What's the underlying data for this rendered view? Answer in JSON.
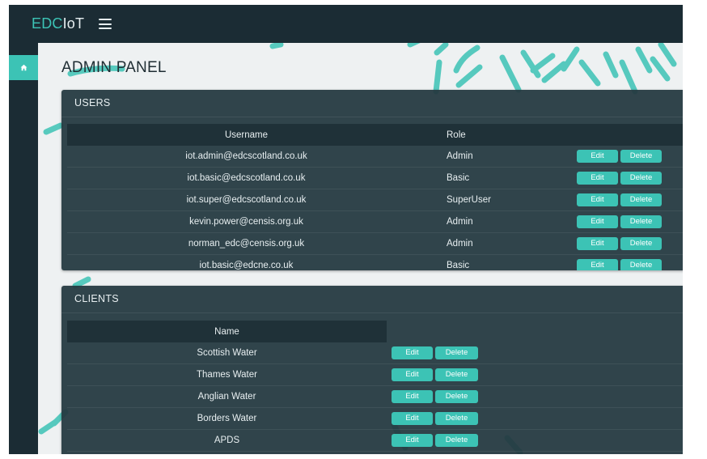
{
  "app": {
    "brand_part1": "EDC",
    "brand_part2": "IoT"
  },
  "page": {
    "title": "ADMIN PANEL"
  },
  "users": {
    "header": "USERS",
    "columns": {
      "username": "Username",
      "role": "Role"
    },
    "rows": [
      {
        "username": "iot.admin@edcscotland.co.uk",
        "role": "Admin"
      },
      {
        "username": "iot.basic@edcscotland.co.uk",
        "role": "Basic"
      },
      {
        "username": "iot.super@edcscotland.co.uk",
        "role": "SuperUser"
      },
      {
        "username": "kevin.power@censis.org.uk",
        "role": "Admin"
      },
      {
        "username": "norman_edc@censis.org.uk",
        "role": "Admin"
      },
      {
        "username": "iot.basic@edcne.co.uk",
        "role": "Basic"
      }
    ]
  },
  "clients": {
    "header": "CLIENTS",
    "columns": {
      "name": "Name"
    },
    "rows": [
      {
        "name": "Scottish Water"
      },
      {
        "name": "Thames Water"
      },
      {
        "name": "Anglian Water"
      },
      {
        "name": "Borders Water"
      },
      {
        "name": "APDS"
      }
    ]
  },
  "actions": {
    "edit": "Edit",
    "delete": "Delete"
  },
  "icons": {
    "menu": "hamburger-menu-icon",
    "home": "home-icon"
  },
  "colors": {
    "accent": "#3cc3b5",
    "topbar": "#1b2c34",
    "panel": "#243840"
  }
}
